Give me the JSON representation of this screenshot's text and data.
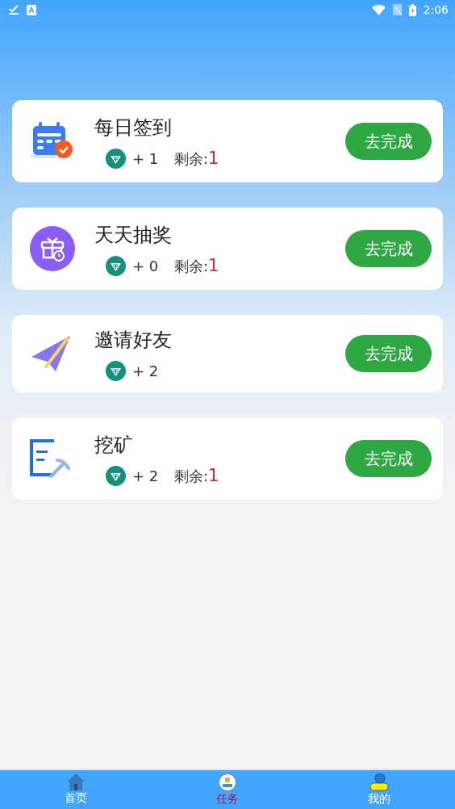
{
  "status_bar": {
    "time": "2:06"
  },
  "tasks": [
    {
      "kind": "calendar",
      "title": "每日签到",
      "reward": "+ 1",
      "remaining_label": "剩余:",
      "remaining": "1",
      "button": "去完成"
    },
    {
      "kind": "gift",
      "title": "天天抽奖",
      "reward": "+ 0",
      "remaining_label": "剩余:",
      "remaining": "1",
      "button": "去完成"
    },
    {
      "kind": "plane",
      "title": "邀请好友",
      "reward": "+ 2",
      "button": "去完成"
    },
    {
      "kind": "mine",
      "title": "挖矿",
      "reward": "+ 2",
      "remaining_label": "剩余:",
      "remaining": "1",
      "button": "去完成"
    }
  ],
  "tabs": [
    {
      "kind": "home",
      "label": "首页",
      "selected": false
    },
    {
      "kind": "task",
      "label": "任务",
      "selected": true
    },
    {
      "kind": "me",
      "label": "我的",
      "selected": false
    }
  ]
}
